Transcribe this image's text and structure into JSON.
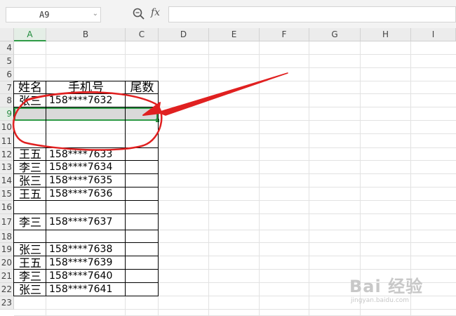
{
  "formula_bar": {
    "name_box_value": "A9",
    "name_box_arrow": "⌄",
    "fx_label": "fx",
    "formula_value": ""
  },
  "columns": [
    "A",
    "B",
    "C",
    "D",
    "E",
    "F",
    "G",
    "H",
    "I"
  ],
  "rows": [
    "4",
    "5",
    "6",
    "7",
    "8",
    "9",
    "10",
    "11",
    "12",
    "13",
    "14",
    "15",
    "16",
    "17",
    "18",
    "19",
    "20",
    "21",
    "22",
    "23"
  ],
  "selected_cell": "A9",
  "table": {
    "header": {
      "name": "姓名",
      "phone": "手机号",
      "tail": "尾数"
    },
    "records": [
      {
        "row": "8",
        "name": "张三",
        "phone": "158****7632"
      },
      {
        "row": "12",
        "name": "王五",
        "phone": "158****7633"
      },
      {
        "row": "13",
        "name": "李三",
        "phone": "158****7634"
      },
      {
        "row": "14",
        "name": "张三",
        "phone": "158****7635"
      },
      {
        "row": "15",
        "name": "王五",
        "phone": "158****7636"
      },
      {
        "row": "17",
        "name": "李三",
        "phone": "158****7637"
      },
      {
        "row": "19",
        "name": "张三",
        "phone": "158****7638"
      },
      {
        "row": "20",
        "name": "王五",
        "phone": "158****7639"
      },
      {
        "row": "21",
        "name": "李三",
        "phone": "158****7640"
      },
      {
        "row": "22",
        "name": "张三",
        "phone": "158****7641"
      }
    ]
  },
  "colors": {
    "selection": "#2e9b46",
    "annotation": "#e02020",
    "selected_fill": "#d9d9d9"
  },
  "watermark": {
    "brand": "Bai 经验",
    "url": "jingyan.baidu.com"
  }
}
